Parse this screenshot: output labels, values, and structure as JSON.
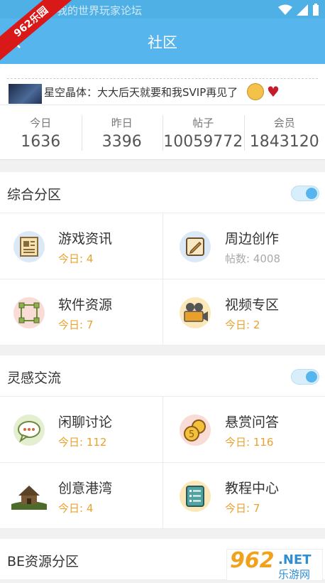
{
  "status_bar": {
    "notification": "我的世界玩家论坛"
  },
  "corner_badge": "962乐园",
  "app_bar": {
    "title": "社区"
  },
  "notice": {
    "text": "星空晶体：大大后天就要和我SVIP再见了"
  },
  "stats": [
    {
      "label": "今日",
      "value": "1636"
    },
    {
      "label": "昨日",
      "value": "3396"
    },
    {
      "label": "帖子",
      "value": "10059772"
    },
    {
      "label": "会员",
      "value": "1843120"
    }
  ],
  "sections": [
    {
      "name": "综合分区",
      "toggle_on": true,
      "items": [
        {
          "name": "游戏资讯",
          "sub": "今日: 4",
          "icon": "news-icon"
        },
        {
          "name": "周边创作",
          "sub": "帖数: 4008",
          "icon": "pencil-icon"
        },
        {
          "name": "软件资源",
          "sub": "今日: 7",
          "icon": "nodes-icon"
        },
        {
          "name": "视频专区",
          "sub": "今日: 2",
          "icon": "video-camera-icon"
        }
      ]
    },
    {
      "name": "灵感交流",
      "toggle_on": true,
      "items": [
        {
          "name": "闲聊讨论",
          "sub": "今日: 112",
          "icon": "chat-bubble-icon"
        },
        {
          "name": "悬赏问答",
          "sub": "今日: 116",
          "icon": "coins-icon"
        },
        {
          "name": "创意港湾",
          "sub": "今日: 4",
          "icon": "house-icon"
        },
        {
          "name": "教程中心",
          "sub": "今日: 7",
          "icon": "list-icon"
        }
      ]
    },
    {
      "name": "BE资源分区"
    }
  ],
  "watermark": {
    "big": "962",
    "net": ".NET",
    "cn": "乐游网"
  },
  "colors": {
    "primary": "#55b5ec",
    "accent_orange": "#eba12b"
  }
}
